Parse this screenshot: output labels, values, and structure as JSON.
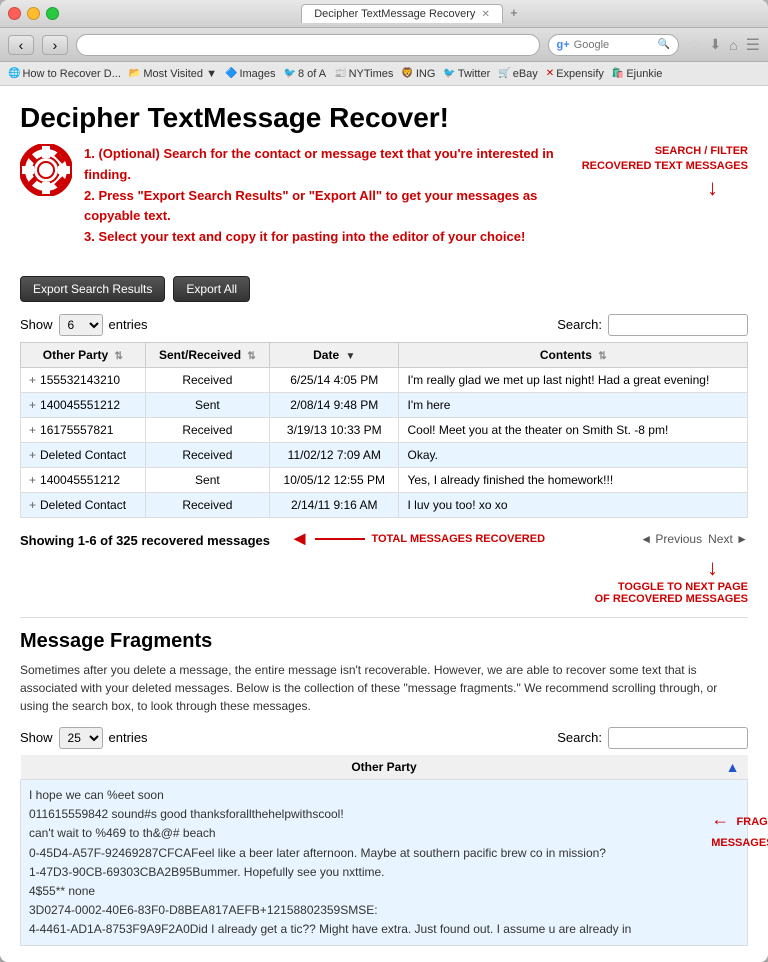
{
  "window": {
    "title": "Decipher TextMessage Recovery",
    "tab_label": "Decipher TextMessage Recovery",
    "tab_plus": "+"
  },
  "toolbar": {
    "address": "",
    "search_placeholder": "Google",
    "back_label": "‹",
    "forward_label": "›"
  },
  "bookmarks": [
    {
      "label": "How to Recover D...",
      "icon": "🌐"
    },
    {
      "label": "Most Visited ▼",
      "icon": ""
    },
    {
      "label": "Images",
      "icon": "🔷"
    },
    {
      "label": "8 of A",
      "icon": "🐦"
    },
    {
      "label": "NYTimes",
      "icon": "📰"
    },
    {
      "label": "ING",
      "icon": "🦁"
    },
    {
      "label": "Twitter",
      "icon": "🐦"
    },
    {
      "label": "eBay",
      "icon": "🛒"
    },
    {
      "label": "Expensify",
      "icon": "💰"
    },
    {
      "label": "Ejunkie",
      "icon": "🛍️"
    }
  ],
  "page": {
    "title": "Decipher TextMessage Recover!",
    "instruction1": "1.  (Optional) Search for the contact or message text that you're interested in finding.",
    "instruction2": "2.  Press \"Export Search Results\" or \"Export All\" to get your messages as copyable text.",
    "instruction3": "3.  Select your text and copy it for pasting into the editor of your choice!",
    "annotation_search": "SEARCH / FILTER\nRECOVERED TEXT MESSAGES"
  },
  "buttons": {
    "export_search": "Export Search Results",
    "export_all": "Export All"
  },
  "table_controls": {
    "show_label": "Show",
    "show_value": "6",
    "entries_label": "entries",
    "search_label": "Search:"
  },
  "table": {
    "headers": [
      "Other Party",
      "Sent/Received",
      "Date",
      "Contents"
    ],
    "rows": [
      {
        "party": "155532143210",
        "type": "Received",
        "date": "6/25/14  4:05 PM",
        "content": "I'm really glad we met up last night! Had a great evening!"
      },
      {
        "party": "140045551212",
        "type": "Sent",
        "date": "2/08/14  9:48 PM",
        "content": "I'm here"
      },
      {
        "party": "16175557821",
        "type": "Received",
        "date": "3/19/13  10:33 PM",
        "content": "Cool! Meet you at the theater on Smith St. -8 pm!"
      },
      {
        "party": "Deleted Contact",
        "type": "Received",
        "date": "11/02/12  7:09 AM",
        "content": "Okay."
      },
      {
        "party": "140045551212",
        "type": "Sent",
        "date": "10/05/12  12:55 PM",
        "content": "Yes, I already finished the homework!!!"
      },
      {
        "party": "Deleted Contact",
        "type": "Received",
        "date": "2/14/11  9:16 AM",
        "content": "I luv you too! xo xo"
      }
    ]
  },
  "showing": {
    "text": "Showing 1-6 of ",
    "count": "325",
    "suffix": " recovered messages",
    "annotation_total": "TOTAL MESSAGES RECOVERED",
    "annotation_next": "TOGGLE TO NEXT PAGE\nOF RECOVERED MESSAGES"
  },
  "pagination": {
    "previous": "◄ Previous",
    "next": "Next ►"
  },
  "fragments": {
    "title": "Message Fragments",
    "description": "Sometimes after you delete a message, the entire message isn't recoverable. However, we are able to recover some text that is associated with your deleted messages. Below is the collection of these \"message fragments.\" We recommend scrolling through, or using the search box, to look through these messages.",
    "show_value": "25",
    "entries_label": "entries",
    "search_label": "Search:",
    "header": "Other Party",
    "annotation": "FRAGMENTS ARE REMNANTS OF\nMESSAGES THAT YOU HAVE DELETED",
    "content": "I hope we can %eet soon\n011615559842    sound#s good thanksforallthehelpwithscool!\ncan't wait to %469 to th&@# beach\n0-45D4-A57F-92469287CFCAFeel like a beer later afternoon. Maybe at southern pacific brew co in mission?\n1-47D3-90CB-69303CBA2B95Bummer. Hopefully see you nxttime.\n4$55** none\n3D0274-0002-40E6-83F0-D8BEA817AEFB+12158802359SMSE:\n4-4461-AD1A-8753F9A9F2A0Did I already get a tic?? Might have extra. Just found out. I assume u are already in"
  }
}
